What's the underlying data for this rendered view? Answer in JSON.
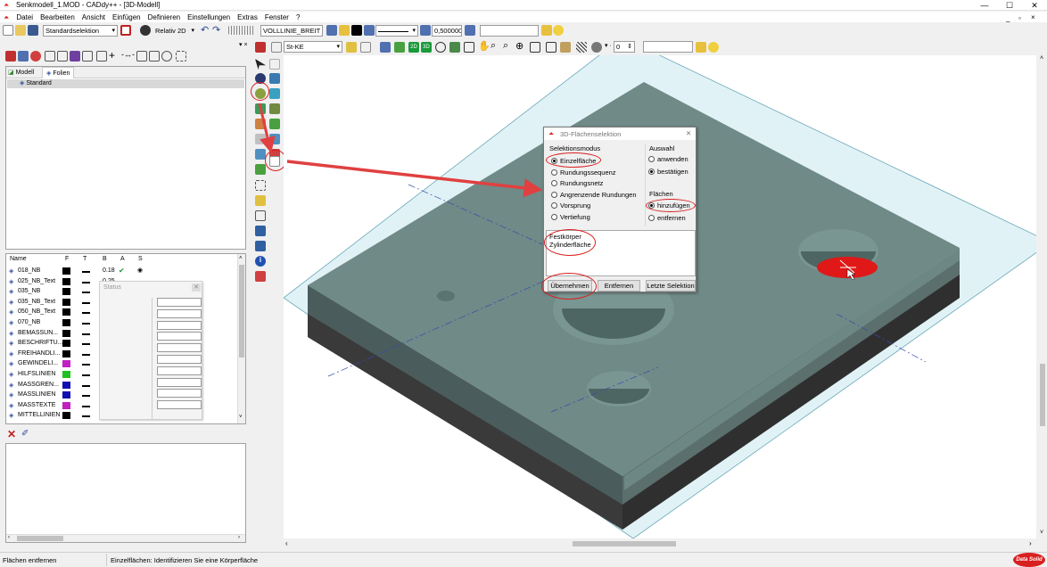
{
  "window": {
    "title": "Senkmodell_1.MOD  -  CADdy++ - [3D-Modell]",
    "controls": [
      "—",
      "☐",
      "✕"
    ],
    "mdi_controls": [
      "_",
      "▫",
      "×"
    ]
  },
  "menu": [
    "Datei",
    "Bearbeiten",
    "Ansicht",
    "Einfügen",
    "Definieren",
    "Einstellungen",
    "Extras",
    "Fenster",
    "?"
  ],
  "toolbar1": {
    "selection_mode": "Standardselektion",
    "relative_mode": "Relativ 2D",
    "line_style": "VOLLLINIE_BREIT",
    "line_width": "0,500000",
    "layer_value": ""
  },
  "toolbar2": {
    "material": "St-KE",
    "counter": "0",
    "search": ""
  },
  "tabs": [
    {
      "label": "Modell"
    },
    {
      "label": "Folien"
    }
  ],
  "tree": {
    "root": "Standard"
  },
  "layer_table": {
    "headers": [
      "Name",
      "F",
      "T",
      "B",
      "A",
      "S"
    ],
    "rows": [
      {
        "name": "018_NB",
        "color": "#000000",
        "b": "0.18"
      },
      {
        "name": "025_NB_Text",
        "color": "#000000",
        "b": "0.25"
      },
      {
        "name": "035_NB",
        "color": "#000000",
        "b": ""
      },
      {
        "name": "035_NB_Text",
        "color": "#000000",
        "b": ""
      },
      {
        "name": "050_NB_Text",
        "color": "#000000",
        "b": ""
      },
      {
        "name": "070_NB",
        "color": "#000000",
        "b": ""
      },
      {
        "name": "BEMASSUN...",
        "color": "#000000",
        "b": ""
      },
      {
        "name": "BESCHRIFTU...",
        "color": "#000000",
        "b": ""
      },
      {
        "name": "FREIHANDLI...",
        "color": "#000000",
        "b": ""
      },
      {
        "name": "GEWINDELI...",
        "color": "#c020c0",
        "b": ""
      },
      {
        "name": "HILFSLINIEN",
        "color": "#20c020",
        "b": ""
      },
      {
        "name": "MASSGREN...",
        "color": "#1010b0",
        "b": ""
      },
      {
        "name": "MASSLINIEN",
        "color": "#1010b0",
        "b": ""
      },
      {
        "name": "MASSTEXTE",
        "color": "#c020c0",
        "b": ""
      },
      {
        "name": "MITTELLINIEN",
        "color": "#000000",
        "b": ""
      }
    ]
  },
  "status_popup": {
    "title": "Status"
  },
  "dialog": {
    "title": "3D-Flächenselektion",
    "close": "✕",
    "mode_group": "Selektionsmodus",
    "modes": [
      {
        "label": "Einzelfläche",
        "checked": true
      },
      {
        "label": "Rundungssequenz",
        "checked": false
      },
      {
        "label": "Rundungsnetz",
        "checked": false
      },
      {
        "label": "Angrenzende Rundungen",
        "checked": false
      },
      {
        "label": "Vorsprung",
        "checked": false
      },
      {
        "label": "Vertiefung",
        "checked": false
      }
    ],
    "choice_group": "Auswahl",
    "choices": [
      {
        "label": "anwenden",
        "checked": false
      },
      {
        "label": "bestätigen",
        "checked": true
      }
    ],
    "faces_group": "Flächen",
    "faces": [
      {
        "label": "hinzufügen",
        "checked": true
      },
      {
        "label": "entfernen",
        "checked": false
      }
    ],
    "info_lines": [
      "Festkörper",
      "Zylinderfläche"
    ],
    "buttons": {
      "apply": "Übernehmen",
      "remove": "Entfernen",
      "last": "Letzte Selektion"
    }
  },
  "statusbar": {
    "left": "Flächen entfernen",
    "message": "Einzelflächen: Identifizieren Sie eine Körperfläche",
    "logo": "Data Solid"
  },
  "colors": {
    "highlight": "#d92020",
    "model_top": "#6f8a87",
    "model_side": "#5b716f",
    "model_bottom": "#3b3b3b",
    "plane": "#c9e8ee"
  }
}
